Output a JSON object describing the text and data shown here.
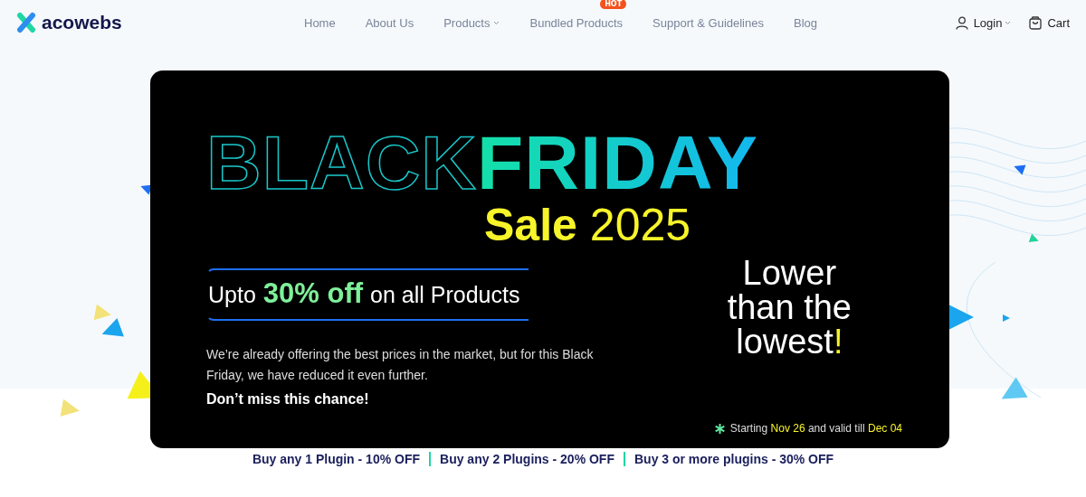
{
  "header": {
    "logo": "acowebs",
    "nav": [
      {
        "label": "Home",
        "has_dropdown": false
      },
      {
        "label": "About Us",
        "has_dropdown": false
      },
      {
        "label": "Products",
        "has_dropdown": true
      },
      {
        "label": "Bundled Products",
        "has_dropdown": false,
        "badge": "HOT"
      },
      {
        "label": "Support & Guidelines",
        "has_dropdown": false
      },
      {
        "label": "Blog",
        "has_dropdown": false
      }
    ],
    "login": "Login",
    "cart": "Cart"
  },
  "banner": {
    "headline_outline": "BLACK",
    "headline_filled": "FRIDAY",
    "sale_word": "Sale",
    "sale_year": "2025",
    "offer_prefix": "Upto",
    "offer_amount": "30% off",
    "offer_suffix": "on all Products",
    "description": "We’re already offering the best prices in the market, but for this Black Friday, we have reduced it even further.",
    "call_to_action": "Don’t miss this chance!",
    "slogan_lines": [
      "Lower",
      "than the",
      "lowest"
    ],
    "slogan_mark": "!",
    "validity": [
      {
        "text": "Starting ",
        "highlight": false
      },
      {
        "text": "Nov 26",
        "highlight": true
      },
      {
        "text": " and valid till ",
        "highlight": false
      },
      {
        "text": "Dec 04",
        "highlight": true
      }
    ]
  },
  "offers": [
    "Buy any 1 Plugin - 10% OFF",
    "Buy any 2 Plugins - 20% OFF",
    "Buy 3 or more plugins - 30% OFF"
  ]
}
